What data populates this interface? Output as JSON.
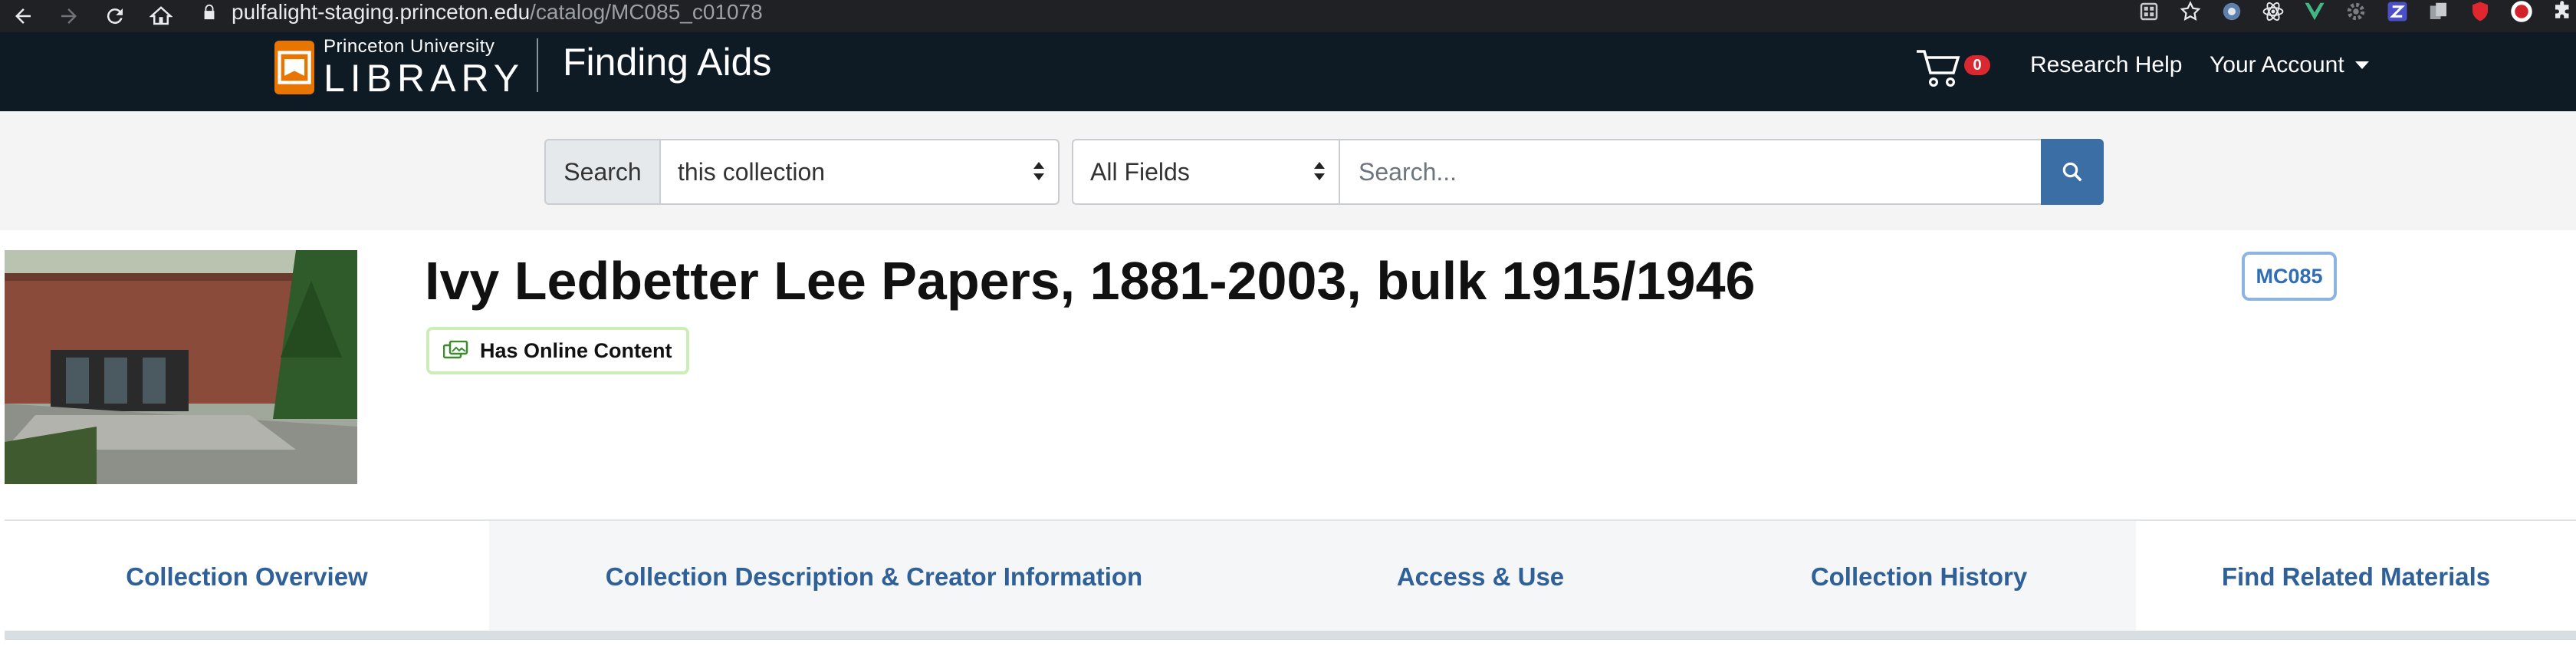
{
  "browser": {
    "url_host": "pulfalight-staging.princeton.edu",
    "url_path": "/catalog/MC085_c01078",
    "nav_icons": [
      "back-icon",
      "forward-icon",
      "reload-icon",
      "home-icon",
      "lock-icon"
    ],
    "extension_icons": [
      "apps-grid-icon",
      "star-icon",
      "extension-circle-icon",
      "react-atom-icon",
      "vue-icon",
      "gear-extension-icon",
      "z-extension-icon",
      "copy-extension-icon",
      "shield-extension-icon",
      "profile-avatar-icon",
      "puzzle-icon"
    ]
  },
  "header": {
    "logo_top": "Princeton University",
    "logo_bottom": "LIBRARY",
    "site_title": "Finding Aids",
    "cart_count": "0",
    "research_help": "Research Help",
    "your_account": "Your Account"
  },
  "search": {
    "label": "Search",
    "scope_value": "this collection",
    "field_value": "All Fields",
    "placeholder": "Search..."
  },
  "record": {
    "title": "Ivy Ledbetter Lee Papers, 1881-2003, bulk 1915/1946",
    "online_badge": "Has Online Content",
    "collection_id": "MC085"
  },
  "tabs": [
    {
      "label": "Collection Overview"
    },
    {
      "label": "Collection Description & Creator Information"
    },
    {
      "label": "Access & Use"
    },
    {
      "label": "Collection History"
    },
    {
      "label": "Find Related Materials"
    }
  ],
  "colors": {
    "header_bg": "#0e1a24",
    "brand_orange": "#e77500",
    "search_button": "#3a6ea5",
    "tab_text": "#2f6097",
    "badge_red": "#d9282f",
    "online_badge_border": "#ccedb8",
    "id_badge_border": "#8bb5e0"
  }
}
